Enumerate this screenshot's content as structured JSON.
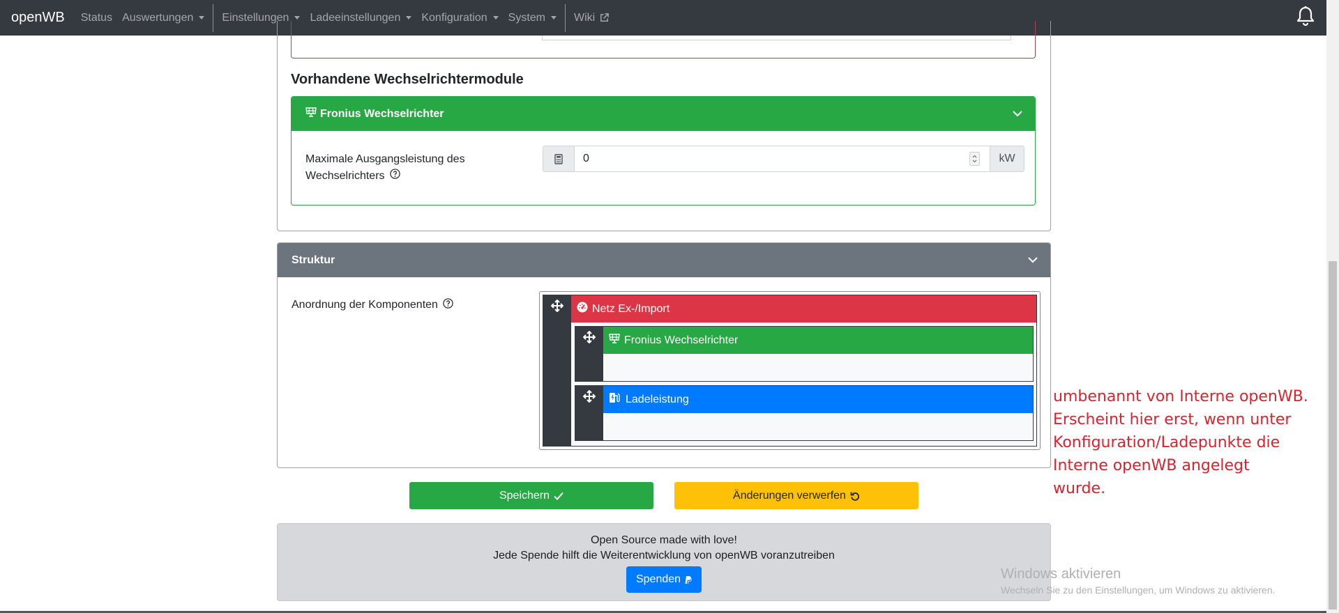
{
  "navbar": {
    "brand": "openWB",
    "items": [
      {
        "label": "Status"
      },
      {
        "label": "Auswertungen"
      },
      {
        "label": "Einstellungen"
      },
      {
        "label": "Ladeeinstellungen"
      },
      {
        "label": "Konfiguration"
      },
      {
        "label": "System"
      },
      {
        "label": "Wiki"
      }
    ],
    "icons": {
      "external": "external-link-icon",
      "bell": "bell-icon"
    }
  },
  "inverters": {
    "heading": "Vorhandene Wechselrichtermodule",
    "card": {
      "title": "Fronius Wechselrichter",
      "icon": "solar-panel-icon",
      "field_label": "Maximale Ausgangsleistung des Wechselrichters",
      "field_value": "0",
      "unit": "kW",
      "accent": "#28a745"
    }
  },
  "structure": {
    "title": "Struktur",
    "label": "Anordnung der Komponenten",
    "nodes": {
      "root": {
        "label": "Netz Ex-/Import",
        "icon": "gauge-icon",
        "color": "#dc3545"
      },
      "child1": {
        "label": "Fronius Wechselrichter",
        "icon": "solar-panel-icon",
        "color": "#28a745"
      },
      "child2": {
        "label": "Ladeleistung",
        "icon": "charging-station-icon",
        "color": "#007bff"
      }
    }
  },
  "buttons": {
    "save": "Speichern",
    "discard": "Änderungen verwerfen"
  },
  "footer": {
    "line1": "Open Source made with love!",
    "line2": "Jede Spende hilft die Weiterentwicklung von openWB voranzutreiben",
    "donate": "Spenden"
  },
  "annotation": {
    "lines": [
      "umbenannt von Interne openWB.",
      "Erscheint hier erst, wenn unter",
      "Konfiguration/Ladepunkte die",
      "Interne openWB angelegt",
      "wurde."
    ]
  },
  "watermark": {
    "title": "Windows aktivieren",
    "subtitle": "Wechseln Sie zu den Einstellungen, um Windows zu aktivieren."
  }
}
